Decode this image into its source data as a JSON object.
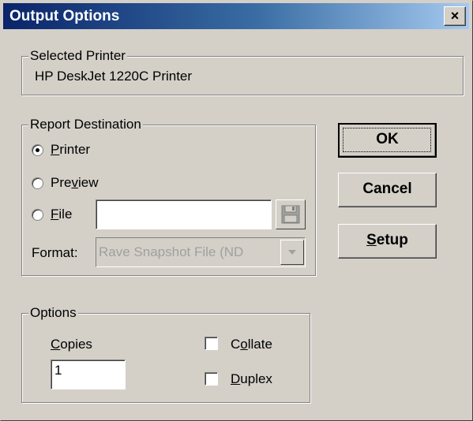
{
  "window": {
    "title": "Output Options",
    "close_label": "×"
  },
  "selected_printer": {
    "legend": "Selected Printer",
    "name": "HP DeskJet 1220C Printer"
  },
  "report_destination": {
    "legend": "Report Destination",
    "options": [
      {
        "label_pre": "",
        "label_u": "P",
        "label_post": "rinter",
        "checked": true
      },
      {
        "label_pre": "Pre",
        "label_u": "v",
        "label_post": "iew",
        "checked": false
      },
      {
        "label_pre": "",
        "label_u": "F",
        "label_post": "ile",
        "checked": false
      }
    ],
    "file_value": "",
    "format_label": "Format:",
    "format_value": "Rave Snapshot File (ND"
  },
  "buttons": {
    "ok": "OK",
    "cancel": "Cancel",
    "setup_u": "S",
    "setup_rest": "etup"
  },
  "options": {
    "legend": "Options",
    "copies_u": "C",
    "copies_rest": "opies",
    "copies_value": "1",
    "collate_pre": "C",
    "collate_u": "o",
    "collate_post": "llate",
    "collate_checked": false,
    "duplex_u": "D",
    "duplex_rest": "uplex",
    "duplex_checked": false
  }
}
